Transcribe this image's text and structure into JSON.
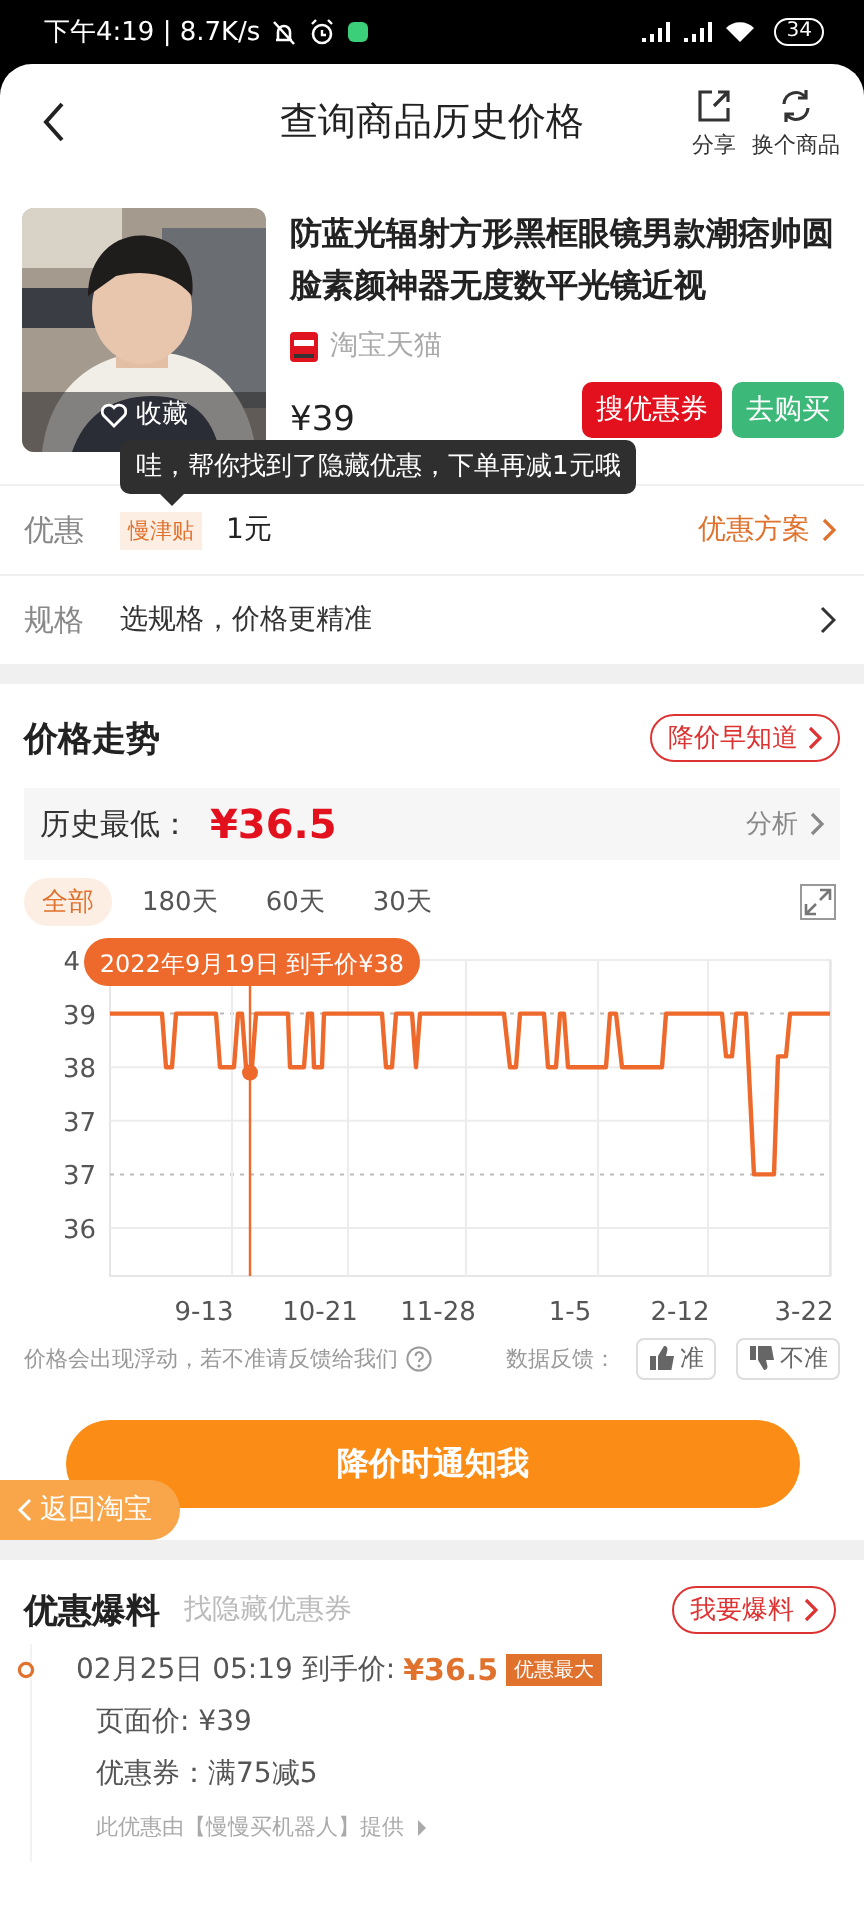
{
  "status_bar": {
    "time_speed": "下午4:19 | 8.7K/s",
    "battery": "34"
  },
  "header": {
    "title": "查询商品历史价格",
    "actions": [
      {
        "label": "分享",
        "kind": "share"
      },
      {
        "label": "换个商品",
        "kind": "refresh"
      }
    ]
  },
  "product": {
    "title": "防蓝光辐射方形黑框眼镜男款潮痞帅圆脸素颜神器无度数平光镜近视",
    "shop": "淘宝天猫",
    "price": "¥39",
    "favorite": "收藏",
    "buttons": [
      {
        "label": "搜优惠券",
        "kind": "coupon"
      },
      {
        "label": "去购买",
        "kind": "buy"
      }
    ]
  },
  "tooltip": "哇，帮你找到了隐藏优惠，下单再减1元哦",
  "discount": {
    "label": "优惠",
    "tag": "慢津贴",
    "value": "1元",
    "link": "优惠方案"
  },
  "spec": {
    "label": "规格",
    "value": "选规格，价格更精准"
  },
  "trend": {
    "title": "价格走势",
    "alert_button": "降价早知道",
    "lowest_label": "历史最低：",
    "lowest_price": "¥36.5",
    "analysis": "分析",
    "ranges": [
      {
        "label": "全部",
        "selected": true
      },
      {
        "label": "180天",
        "selected": false
      },
      {
        "label": "60天",
        "selected": false
      },
      {
        "label": "30天",
        "selected": false
      }
    ],
    "chart": {
      "y_labels": [
        "4",
        "39",
        "38",
        "37",
        "37",
        "36"
      ],
      "x_labels": [
        "9-13",
        "10-21",
        "11-28",
        "1-5",
        "2-12",
        "3-22"
      ],
      "tooltip": "2022年9月19日 到手价¥38"
    },
    "note": "价格会出现浮动，若不准请反馈给我们",
    "feedback_label": "数据反馈：",
    "feedback": [
      {
        "label": "准",
        "kind": "up"
      },
      {
        "label": "不准",
        "kind": "down"
      }
    ]
  },
  "notify_button": "降价时通知我",
  "back_button": "返回淘宝",
  "deals": {
    "title": "优惠爆料",
    "subtitle": "找隐藏优惠券",
    "report_button": "我要爆料",
    "items": [
      {
        "time": "02月25日 05:19 到手价:",
        "price": "¥36.5",
        "badge": "优惠最大",
        "page_price": "页面价: ¥39",
        "coupon": "优惠券：满75减5",
        "source": "此优惠由【慢慢买机器人】提供"
      }
    ]
  }
}
